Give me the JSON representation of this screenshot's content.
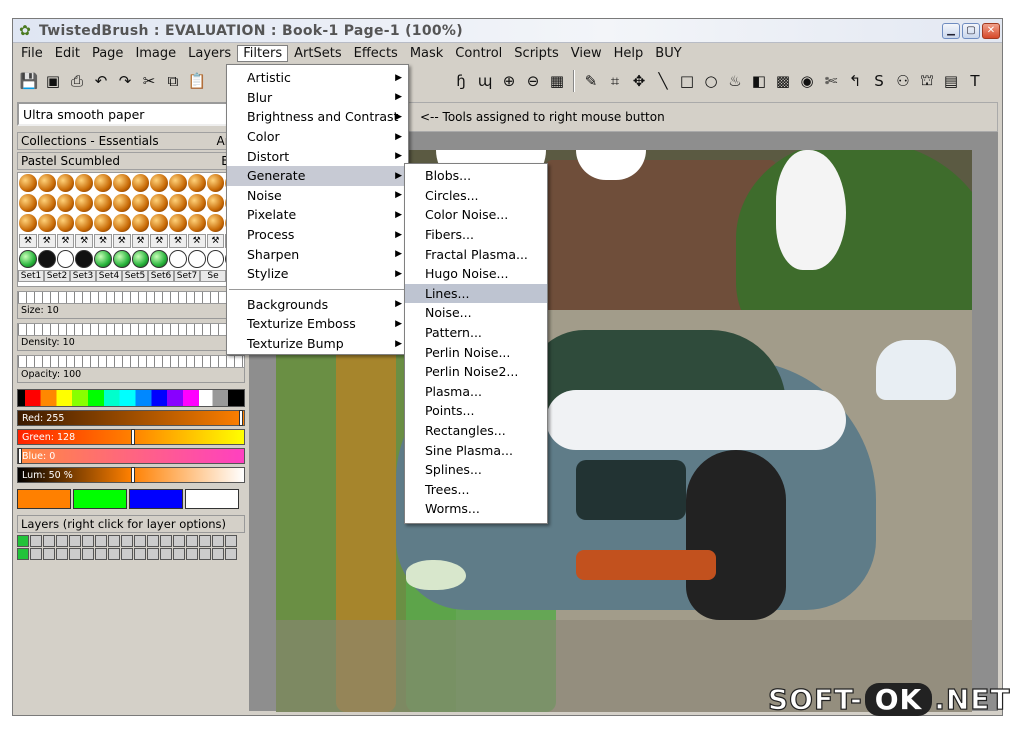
{
  "window": {
    "title": "TwistedBrush : EVALUATION : Book-1 Page-1 (100%)"
  },
  "menubar": [
    "File",
    "Edit",
    "Page",
    "Image",
    "Layers",
    "Filters",
    "ArtSets",
    "Effects",
    "Mask",
    "Control",
    "Scripts",
    "View",
    "Help",
    "BUY"
  ],
  "left": {
    "paper": "Ultra smooth paper",
    "collection": "Collections - Essentials",
    "collection_tag": "ArtS",
    "brush": "Pastel Scumbled",
    "brush_tag": "Bru",
    "sets": [
      "Set1",
      "Set2",
      "Set3",
      "Set4",
      "Set5",
      "Set6",
      "Set7",
      "Se"
    ],
    "size_label": "Size: 10",
    "density_label": "Density: 10",
    "opacity_label": "Opacity: 100",
    "red_label": "Red: 255",
    "green_label": "Green: 128",
    "blue_label": "Blue: 0",
    "lum_label": "Lum: 50 %",
    "layers_label": "Layers (right click for layer options)"
  },
  "hint": "<-- Tools assigned to right mouse button",
  "filters_menu": {
    "items": [
      "Artistic",
      "Blur",
      "Brightness and Contrast",
      "Color",
      "Distort",
      "Generate",
      "Noise",
      "Pixelate",
      "Process",
      "Sharpen",
      "Stylize"
    ],
    "items2": [
      "Backgrounds",
      "Texturize Emboss",
      "Texturize Bump"
    ]
  },
  "generate_menu": {
    "items": [
      "Blobs...",
      "Circles...",
      "Color Noise...",
      "Fibers...",
      "Fractal Plasma...",
      "Hugo Noise...",
      "Lines...",
      "Noise...",
      "Pattern...",
      "Perlin Noise...",
      "Perlin Noise2...",
      "Plasma...",
      "Points...",
      "Rectangles...",
      "Sine Plasma...",
      "Splines...",
      "Trees...",
      "Worms..."
    ]
  },
  "watermark": {
    "left": "SOFT-",
    "mid": "OK",
    "right": ".NET"
  },
  "colors": {
    "accent": "#c7cad4",
    "primary": "#ff8000",
    "secondary": "#00ff00",
    "tertiary": "#0000ff"
  }
}
